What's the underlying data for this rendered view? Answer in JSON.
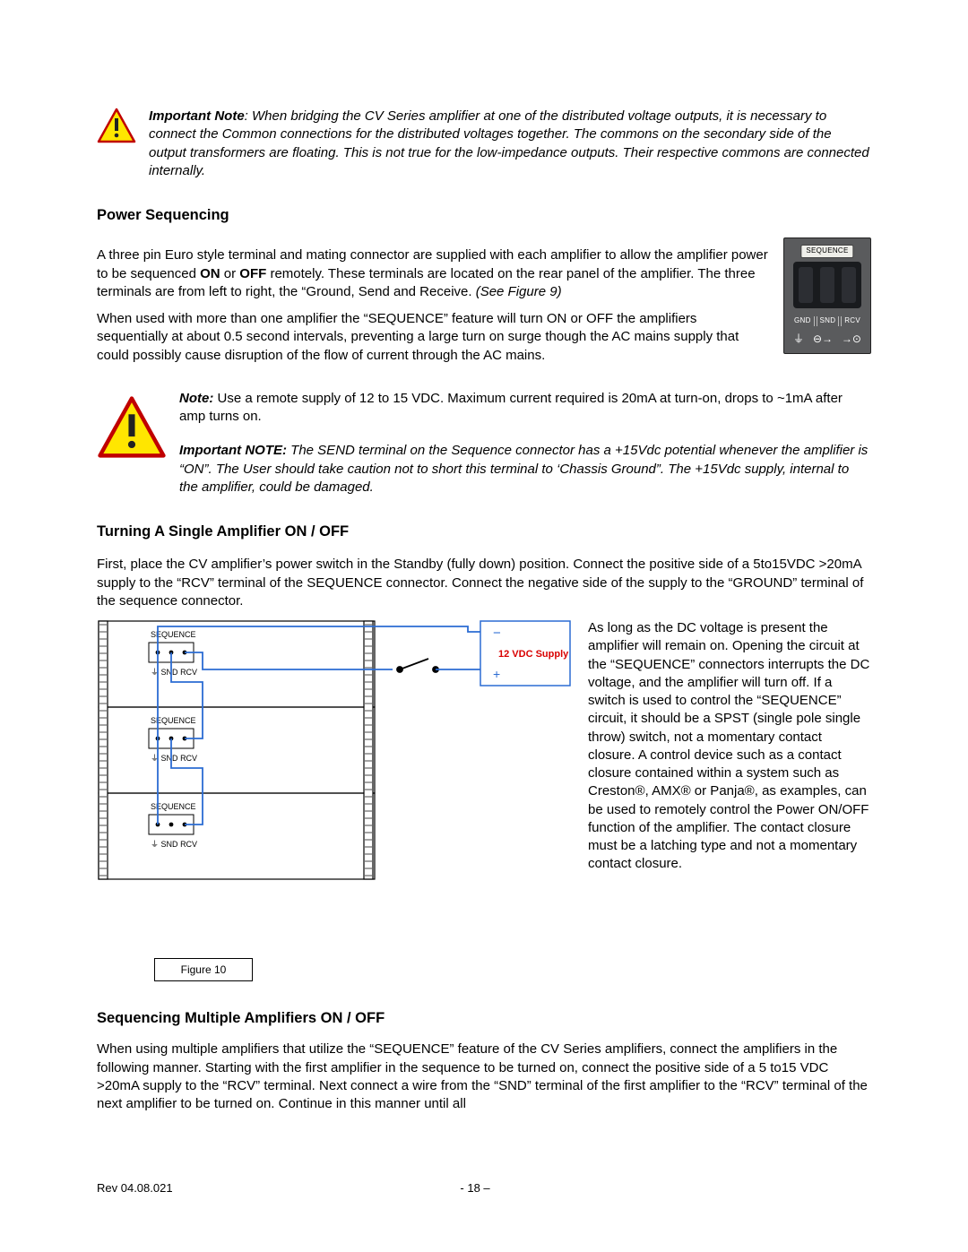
{
  "note1": {
    "lead": "Important Note",
    "body": ":  When bridging the CV Series amplifier at one of the distributed voltage outputs, it is necessary to connect the Common connections for the distributed voltages together. The commons on the secondary side of the output transformers are floating.  This is not true for the low-impedance outputs.  Their respective commons are connected internally."
  },
  "heading1": "Power Sequencing",
  "para1a": "A three pin Euro style terminal and mating connector are supplied with each amplifier to allow the amplifier power to be sequenced ",
  "para1_on": "ON",
  "para1_or": " or ",
  "para1_off": "OFF",
  "para1b": " remotely.  These terminals are located on the rear panel of the amplifier.  The three terminals are from left to right, the “Ground, Send and Receive.  ",
  "figref9": "(See Figure 9)",
  "para2": "When used with more than one amplifier the “SEQUENCE” feature will turn ON or OFF the amplifiers sequentially at about 0.5 second intervals, preventing a large turn on surge though the AC mains supply that could possibly cause disruption of the flow of current through the AC mains.",
  "note2": {
    "lead": "Note:",
    "body": "  Use a remote supply of 12 to 15 VDC.  Maximum current required is 20mA at turn-on, drops to ~1mA after amp turns on."
  },
  "note3": {
    "lead": "Important NOTE:",
    "body": "  The SEND terminal on the Sequence connector has a +15Vdc potential whenever the amplifier is “ON”.  The User should take caution not to short this terminal to ‘Chassis Ground”.  The +15Vdc supply, internal to the amplifier, could be damaged."
  },
  "heading2": "Turning A Single Amplifier ON / OFF",
  "para3": "First, place the CV amplifier’s power switch in the Standby (fully down) position.  Connect the positive side of a 5to15VDC >20mA supply to the “RCV” terminal of the SEQUENCE connector.  Connect the negative side of the supply to the “GROUND” terminal of the sequence connector.",
  "para4": "As long as the DC voltage is present the amplifier will remain on.  Opening the circuit at the “SEQUENCE” connectors interrupts the DC voltage, and the amplifier will turn off.  If a switch is used to control the “SEQUENCE” circuit, it should be a SPST (single pole single throw) switch, not a momentary contact closure.  A control device such as a contact closure contained within a system such as Creston®, AMX® or Panja®, as examples, can be used to remotely control the Power ON/OFF function of the amplifier.  The contact closure must be a latching type and not a momentary contact closure.",
  "heading3": "Sequencing Multiple Amplifiers ON / OFF",
  "para5": "When using multiple amplifiers that utilize the “SEQUENCE” feature of the CV Series amplifiers, connect the amplifiers in the following manner.  Starting with the first amplifier in the sequence to be turned on, connect the positive side of a 5 to15 VDC >20mA supply to the “RCV” terminal.  Next connect a wire from the “SND” terminal of the first amplifier to the “RCV” terminal of the next amplifier to be turned on.  Continue in this manner until all",
  "figure10": {
    "caption": "Figure 10",
    "seq_label": "SEQUENCE",
    "gnd_sym": "⏚",
    "snd_label": "SND",
    "rcv_label": "RCV",
    "supply_line1": "12 VDC Supply",
    "minus": "−",
    "plus": "+"
  },
  "figure9": {
    "seq_label": "SEQUENCE",
    "gnd": "GND",
    "snd": "SND",
    "rcv": "RCV"
  },
  "footer": {
    "rev": "Rev 04.08.021",
    "page": "- 18 –"
  }
}
